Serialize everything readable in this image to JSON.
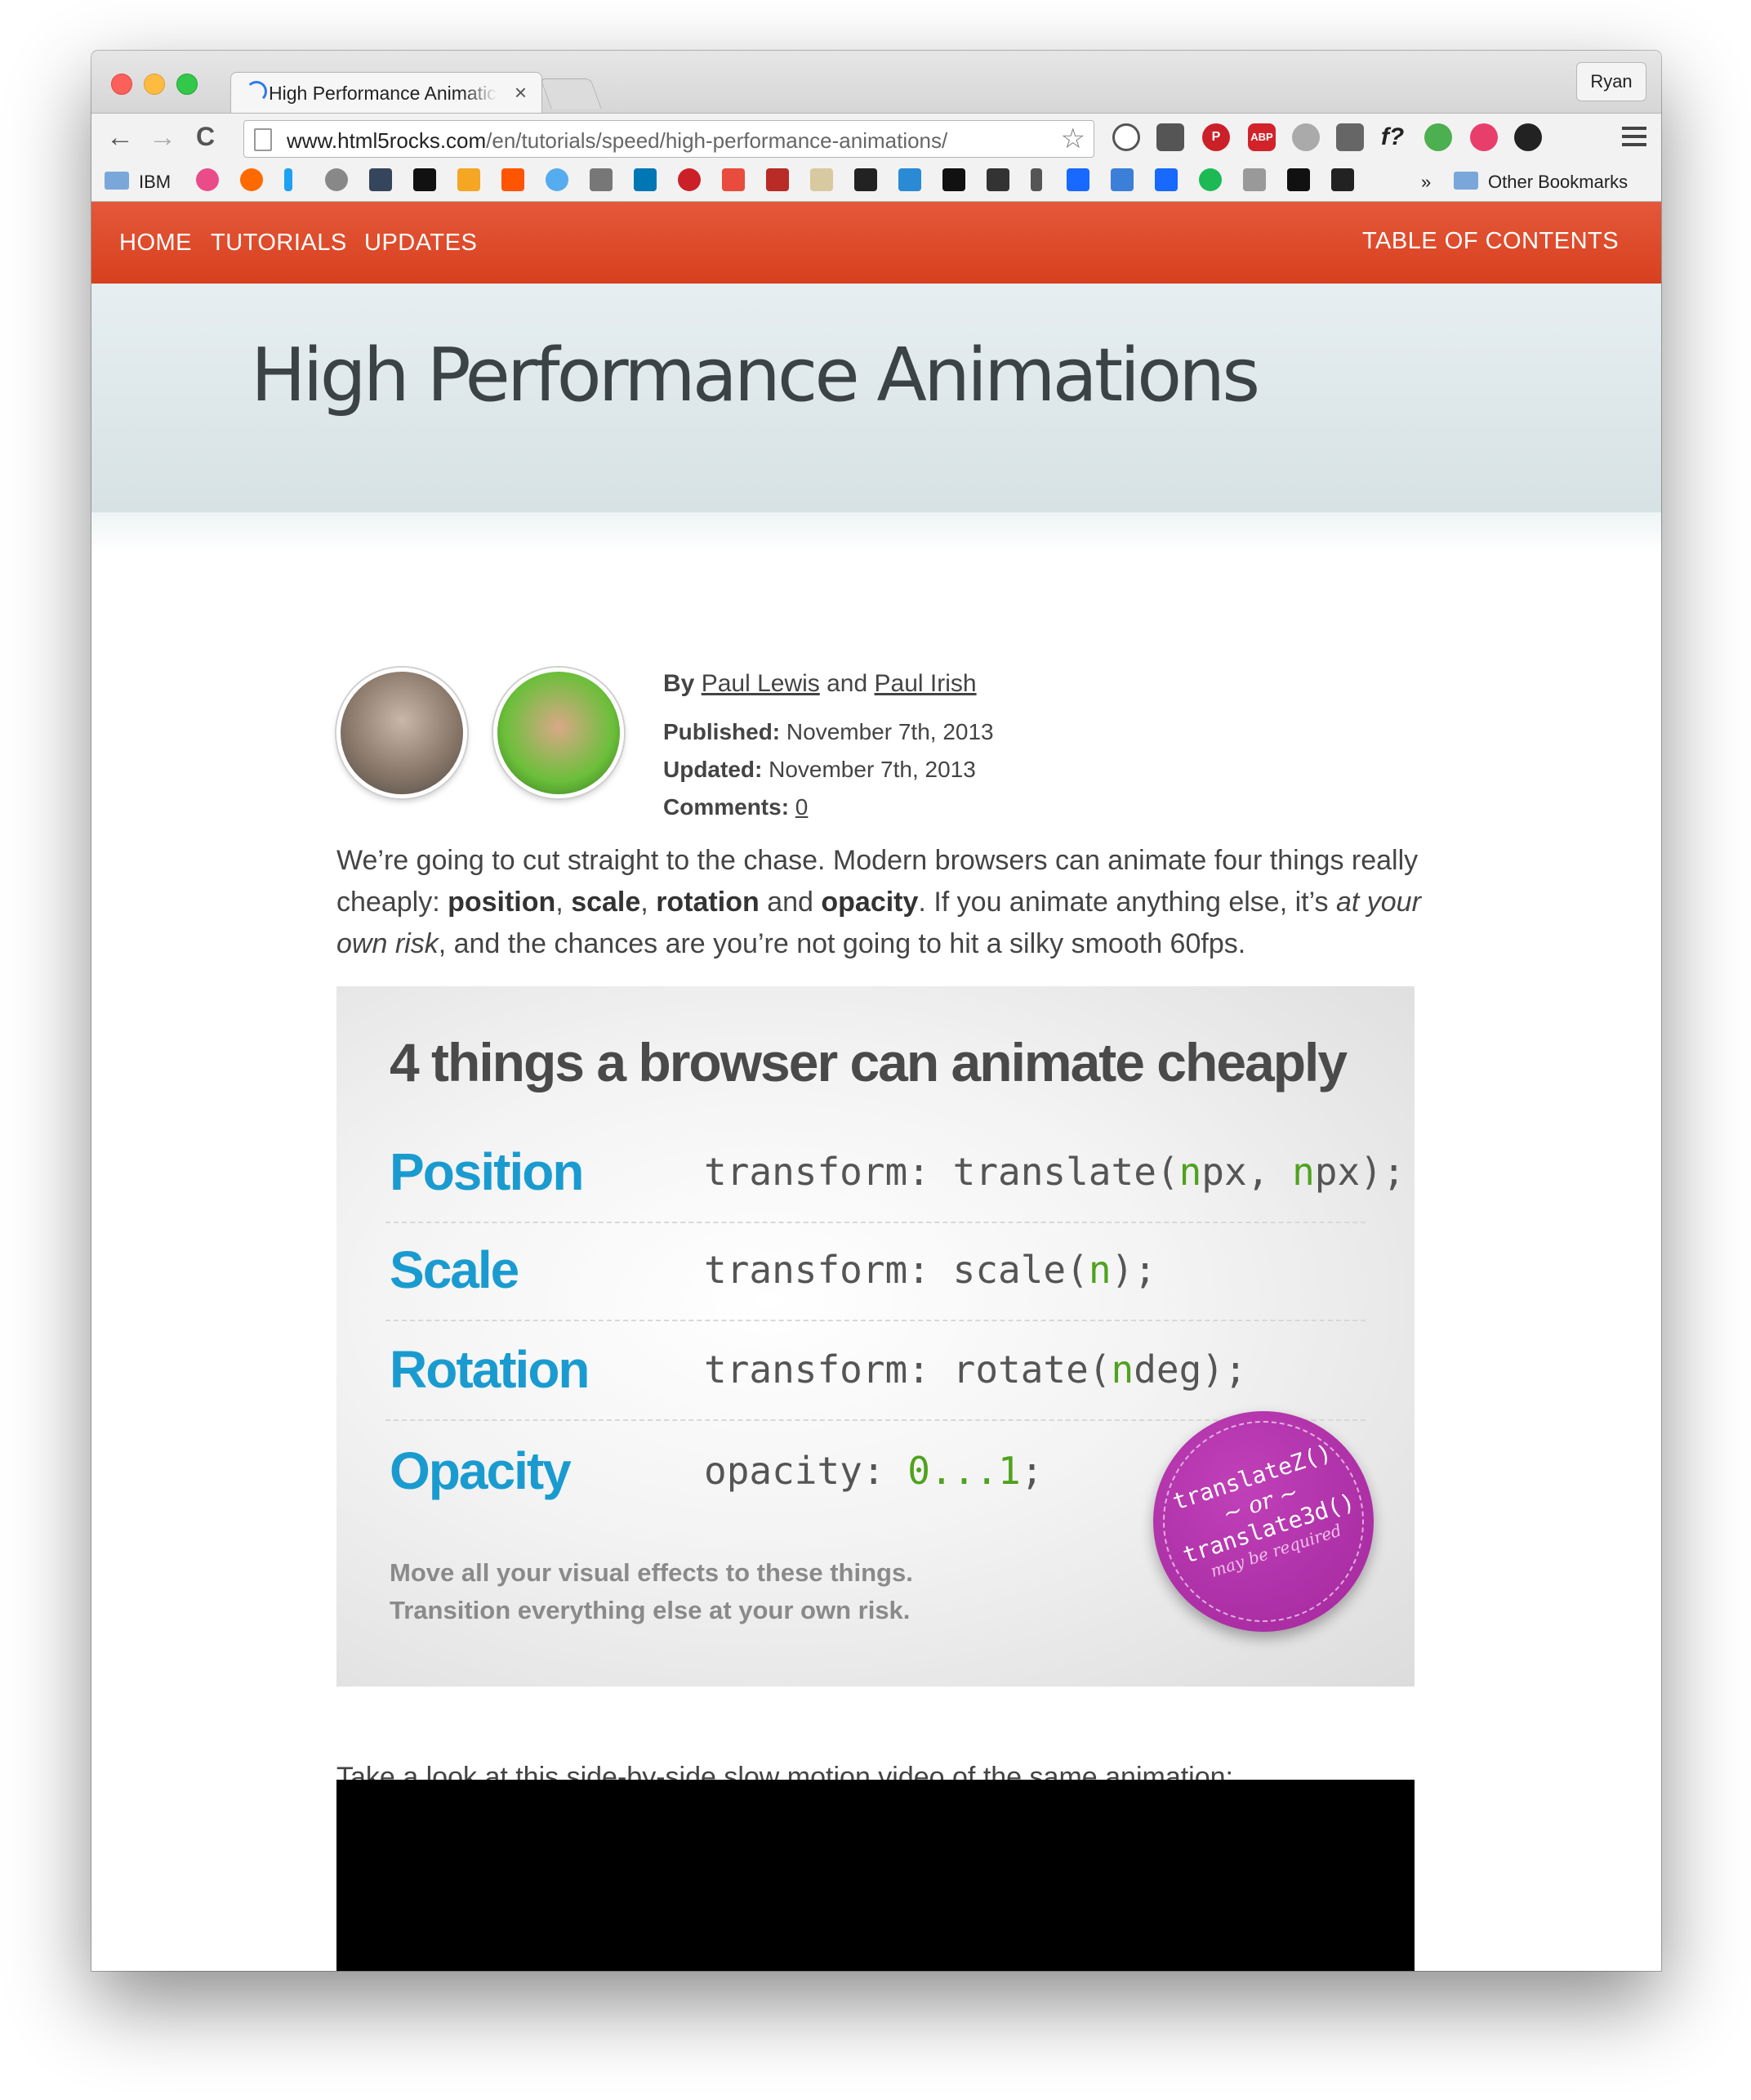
{
  "browser": {
    "tab_title": "High Performance Animatic",
    "tab_close": "×",
    "profile": "Ryan",
    "url_host": "www.html5rocks.com",
    "url_path": "/en/tutorials/speed/high-performance-animations/",
    "back": "←",
    "forward": "→",
    "reload": "C",
    "star": "☆",
    "bookmarks": {
      "first_folder": "IBM",
      "overflow": "»",
      "other": "Other Bookmarks"
    },
    "extensions": {
      "abp": "ABP",
      "fq": "f?"
    }
  },
  "site_nav": {
    "home": "HOME",
    "tutorials": "TUTORIALS",
    "updates": "UPDATES",
    "toc": "TABLE OF CONTENTS"
  },
  "article": {
    "title": "High Performance Animations",
    "by": "By",
    "author1": "Paul Lewis",
    "and": "and",
    "author2": "Paul Irish",
    "published_label": "Published:",
    "published": "November 7th, 2013",
    "updated_label": "Updated:",
    "updated": "November 7th, 2013",
    "comments_label": "Comments:",
    "comments": "0",
    "intro": {
      "p1": "We’re going to cut straight to the chase. Modern browsers can animate four things really cheaply: ",
      "position": "position",
      "comma1": ", ",
      "scale": "scale",
      "comma2": ", ",
      "rotation": "rotation",
      "and": " and ",
      "opacity": "opacity",
      "p2": ". If you animate anything else, it’s ",
      "risk": "at your own risk",
      "p3": ", and the chances are you’re not going to hit a silky smooth 60fps."
    },
    "video_caption": "Take a look at this side-by-side slow motion video of the same animation:"
  },
  "figure": {
    "title": "4 things a browser can animate cheaply",
    "rows": [
      {
        "name": "Position",
        "code_a": "transform: translate(",
        "n1": "n",
        "code_b": "px, ",
        "n2": "n",
        "code_c": "px);"
      },
      {
        "name": "Scale",
        "code_a": "transform: scale(",
        "n1": "n",
        "code_b": ");"
      },
      {
        "name": "Rotation",
        "code_a": "transform: rotate(",
        "n1": "n",
        "code_b": "deg);"
      },
      {
        "name": "Opacity",
        "code_a": "opacity: ",
        "n1": "0...1",
        "code_b": ";"
      }
    ],
    "note1": "Move all your visual effects to these things.",
    "note2": "Transition everything else at your own risk.",
    "badge": {
      "line1": "translateZ()",
      "line2": "~ or ~",
      "line3": "translate3d()",
      "line4": "may be required"
    }
  },
  "colors": {
    "nav_bg": "#dc4a28",
    "accent_blue": "#1a9bd0",
    "code_green": "#4fa21e",
    "badge": "#b030a8"
  }
}
